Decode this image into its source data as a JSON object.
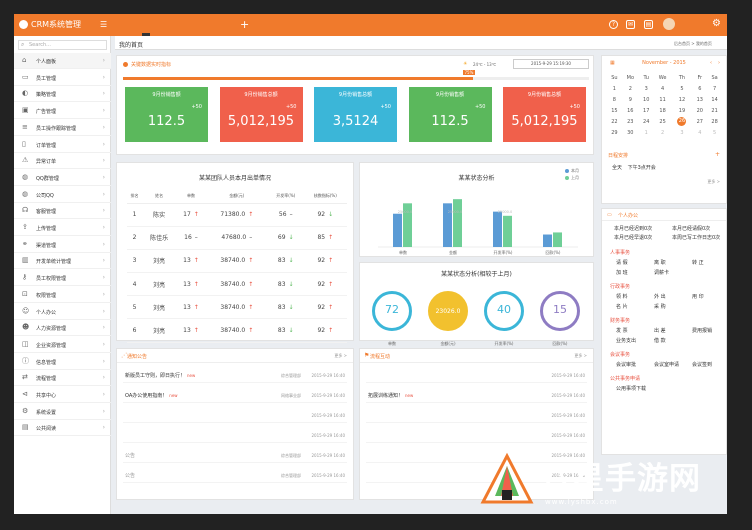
{
  "topbar": {
    "logo": "CRM系统管理",
    "tabs": [
      "",
      "",
      "",
      ""
    ],
    "user": "",
    "tooltip": ""
  },
  "sidebar": {
    "search_placeholder": "Search...",
    "items": [
      {
        "label": "个人面板",
        "icon": "home-icon"
      },
      {
        "label": "员工管理",
        "icon": "folder-icon"
      },
      {
        "label": "策略管理",
        "icon": "bulb-icon"
      },
      {
        "label": "广告管理",
        "icon": "image-icon"
      },
      {
        "label": "员工操作跟踪管理",
        "icon": "list-icon"
      },
      {
        "label": "订单管理",
        "icon": "file-icon"
      },
      {
        "label": "异常订单",
        "icon": "warning-icon"
      },
      {
        "label": "QQ群管理",
        "icon": "qq-icon"
      },
      {
        "label": "公司QQ",
        "icon": "qq-icon"
      },
      {
        "label": "客服管理",
        "icon": "headset-icon"
      },
      {
        "label": "上传管理",
        "icon": "upload-icon"
      },
      {
        "label": "渠道管理",
        "icon": "link-icon"
      },
      {
        "label": "开发单统计管理",
        "icon": "chart-icon"
      },
      {
        "label": "员工权限管理",
        "icon": "key-icon"
      },
      {
        "label": "权限管理",
        "icon": "lock-icon"
      },
      {
        "label": "个人办公",
        "icon": "person-icon"
      },
      {
        "label": "人力资源管理",
        "icon": "people-icon"
      },
      {
        "label": "企业资源管理",
        "icon": "box-icon"
      },
      {
        "label": "信息管理",
        "icon": "info-icon"
      },
      {
        "label": "流程管理",
        "icon": "flow-icon"
      },
      {
        "label": "共享中心",
        "icon": "share-icon"
      },
      {
        "label": "系统设置",
        "icon": "gear-icon"
      },
      {
        "label": "公共阅读",
        "icon": "book-icon"
      }
    ]
  },
  "breadcrumb": {
    "title": "我的首页",
    "subtitle": "",
    "path": "后台首页 > 我的首页"
  },
  "status": {
    "title": "关键数据实时指标",
    "temp": "24℃ - 13℃",
    "datetime": "2015-9-29 15:19:30",
    "progress_label": "75%",
    "progress": 0.75
  },
  "kpis": [
    {
      "label": "9月份销售额",
      "delta": "+50",
      "value": "112.5",
      "color": "#5bb85c"
    },
    {
      "label": "9月份销售总额",
      "delta": "+50",
      "value": "5,012,195",
      "color": "#f0604b"
    },
    {
      "label": "9月份销售总额",
      "delta": "+50",
      "value": "3,5124",
      "color": "#3bb6d8"
    },
    {
      "label": "9月份销售额",
      "delta": "+50",
      "value": "112.5",
      "color": "#5bb85c"
    },
    {
      "label": "9月份销售总额",
      "delta": "+50",
      "value": "5,012,195",
      "color": "#f0604b"
    }
  ],
  "team_table": {
    "title": "某某团队人员本月出单情况",
    "headers": [
      "排名",
      "姓名",
      "单数",
      "金额(元)",
      "开发率(%)",
      "核数指标(%)"
    ],
    "rows": [
      {
        "rank": "1",
        "name": "陈实",
        "count": "17",
        "count_t": "↑",
        "amount": "71380.0",
        "amount_t": "↑",
        "rate": "56",
        "rate_t": "–",
        "idx": "92",
        "idx_t": "↓"
      },
      {
        "rank": "2",
        "name": "陈佳乐",
        "count": "16",
        "count_t": "–",
        "amount": "47680.0",
        "amount_t": "–",
        "rate": "69",
        "rate_t": "↓",
        "idx": "85",
        "idx_t": "↑"
      },
      {
        "rank": "3",
        "name": "刘亮",
        "count": "13",
        "count_t": "↑",
        "amount": "38740.0",
        "amount_t": "↑",
        "rate": "83",
        "rate_t": "↓",
        "idx": "92",
        "idx_t": "↑"
      },
      {
        "rank": "4",
        "name": "刘亮",
        "count": "13",
        "count_t": "↑",
        "amount": "38740.0",
        "amount_t": "↑",
        "rate": "83",
        "rate_t": "↓",
        "idx": "92",
        "idx_t": "↑"
      },
      {
        "rank": "5",
        "name": "刘亮",
        "count": "13",
        "count_t": "↑",
        "amount": "38740.0",
        "amount_t": "↑",
        "rate": "83",
        "rate_t": "↓",
        "idx": "92",
        "idx_t": "↑"
      },
      {
        "rank": "6",
        "name": "刘亮",
        "count": "13",
        "count_t": "↑",
        "amount": "38740.0",
        "amount_t": "↑",
        "rate": "83",
        "rate_t": "↓",
        "idx": "92",
        "idx_t": "↑"
      },
      {
        "rank": "7",
        "name": "刘亮",
        "count": "13",
        "count_t": "↑",
        "amount": "38740.0",
        "amount_t": "↑",
        "rate": "83",
        "rate_t": "↓",
        "idx": "92",
        "idx_t": "↑"
      }
    ]
  },
  "chart_data": {
    "type": "bar",
    "title": "某某状态分析",
    "categories": [
      "单数",
      "金额",
      "开发率(%)",
      "回款(%)"
    ],
    "series": [
      {
        "name": "本月",
        "values": [
          16,
          21,
          17,
          6
        ],
        "color": "#5b9bd5"
      },
      {
        "name": "上月",
        "values": [
          21,
          23,
          15,
          7
        ],
        "color": "#6fcf97"
      }
    ],
    "ylim": [
      0,
      25
    ],
    "annotations": [
      "25000.0",
      "25000.0",
      "25000.0"
    ]
  },
  "gauges": {
    "title": "某某状态分析(相较于上月)",
    "items": [
      {
        "value": "72",
        "label": "单数",
        "color": "#3bb6d8"
      },
      {
        "value": "23026.0",
        "label": "金额(元)",
        "color": "#f2c12e",
        "sub": "金额"
      },
      {
        "value": "40",
        "label": "开发率(%)",
        "color": "#3bb6d8"
      },
      {
        "value": "15",
        "label": "回款(%)",
        "color": "#8e7cc3"
      }
    ]
  },
  "notices": {
    "title": "通知公告",
    "more": "更多 >",
    "rows": [
      {
        "title": "新版员工守则，即日执行！",
        "isnew": "new",
        "dept": "综合管理部",
        "date": "2015-9-29 16:40",
        "grey": false
      },
      {
        "title": "OA办公使用指南！",
        "isnew": "new",
        "dept": "网络事业部",
        "date": "2015-9-29 16:40",
        "grey": false
      },
      {
        "title": "",
        "isnew": "",
        "dept": "",
        "date": "2015-9-29 16:40",
        "grey": true
      },
      {
        "title": "",
        "isnew": "",
        "dept": "",
        "date": "2015-9-29 16:40",
        "grey": true
      },
      {
        "title": "公告",
        "isnew": "",
        "dept": "综合管理部",
        "date": "2015-9-29 16:40",
        "grey": true
      },
      {
        "title": "公告",
        "isnew": "",
        "dept": "综合管理部",
        "date": "2015-9-29 16:40",
        "grey": true
      }
    ]
  },
  "news": {
    "title": "流程互动",
    "more": "更多 >",
    "rows": [
      {
        "title": "",
        "date": "2015-9-29 16:40",
        "grey": false
      },
      {
        "title": "拓展训练通知！",
        "isnew": "new",
        "date": "2015-9-29 16:40",
        "grey": false
      },
      {
        "title": "",
        "date": "2015-9-29 16:40",
        "grey": true
      },
      {
        "title": "",
        "date": "2015-9-29 16:40",
        "grey": true
      },
      {
        "title": "",
        "date": "2015-9-29 16:40",
        "grey": true
      },
      {
        "title": "",
        "date": "2015-9-29 16:40",
        "grey": true
      }
    ]
  },
  "calendar": {
    "month": "November - 2015",
    "weekdays": [
      "Su",
      "Mo",
      "Tu",
      "We",
      "Th",
      "Fr",
      "Sa"
    ],
    "weeks": [
      [
        {
          "d": "1"
        },
        {
          "d": "2"
        },
        {
          "d": "3"
        },
        {
          "d": "4"
        },
        {
          "d": "5"
        },
        {
          "d": "6"
        },
        {
          "d": "7"
        }
      ],
      [
        {
          "d": "8"
        },
        {
          "d": "9"
        },
        {
          "d": "10"
        },
        {
          "d": "11"
        },
        {
          "d": "12"
        },
        {
          "d": "13"
        },
        {
          "d": "14"
        }
      ],
      [
        {
          "d": "15"
        },
        {
          "d": "16"
        },
        {
          "d": "17"
        },
        {
          "d": "18"
        },
        {
          "d": "19"
        },
        {
          "d": "20"
        },
        {
          "d": "21"
        }
      ],
      [
        {
          "d": "22"
        },
        {
          "d": "23"
        },
        {
          "d": "24"
        },
        {
          "d": "25"
        },
        {
          "d": "26"
        },
        {
          "d": "27"
        },
        {
          "d": "28"
        }
      ],
      [
        {
          "d": "29"
        },
        {
          "d": "30"
        },
        {
          "d": "1",
          "m": 1
        },
        {
          "d": "2",
          "m": 1
        },
        {
          "d": "3",
          "m": 1
        },
        {
          "d": "4",
          "m": 1
        },
        {
          "d": "5",
          "m": 1
        }
      ]
    ],
    "today": "26"
  },
  "agenda": {
    "title": "日程安排",
    "items": [
      {
        "label": "全天",
        "text": "下午3点开会"
      }
    ],
    "more": "更多 >"
  },
  "office": {
    "title": "个人办公",
    "summary": [
      "本月已经迟到0次",
      "本月已经请假0次",
      "本月已经早退0次",
      "本周已写工作日志0次"
    ],
    "groups": [
      {
        "head": "人事事务",
        "items": [
          "请 假",
          "离 职",
          "转 正",
          "加 班",
          "调薪卡"
        ]
      },
      {
        "head": "行政事务",
        "items": [
          "领 料",
          "外 出",
          "用 印",
          "名 片",
          "采 购"
        ]
      },
      {
        "head": "财务事务",
        "items": [
          "发 票",
          "出 差",
          "费用报销",
          "业务支出",
          "借 款"
        ]
      },
      {
        "head": "会议事务",
        "items": [
          "会议审批",
          "会议室申请",
          "会议签到"
        ]
      },
      {
        "head": "公共事务申请",
        "items": [
          "公用事项下载"
        ]
      }
    ]
  },
  "watermark": {
    "text": "八星手游网",
    "url": "www.lyshbx.com"
  }
}
